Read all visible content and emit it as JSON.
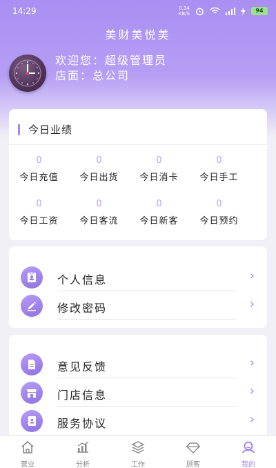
{
  "status_bar": {
    "time": "14:29",
    "net_speed_value": "0.34",
    "net_speed_unit": "KB/S",
    "battery": "94"
  },
  "app": {
    "title": "美财美悦美"
  },
  "user": {
    "welcome": "欢迎您：超级管理员",
    "store": "店面：总公司"
  },
  "performance": {
    "title": "今日业绩",
    "stats": [
      {
        "label": "今日充值",
        "value": "0"
      },
      {
        "label": "今日出货",
        "value": "0"
      },
      {
        "label": "今日消卡",
        "value": "0"
      },
      {
        "label": "今日手工",
        "value": "0"
      },
      {
        "label": "今日工资",
        "value": "0"
      },
      {
        "label": "今日客流",
        "value": "0"
      },
      {
        "label": "今日新客",
        "value": "0"
      },
      {
        "label": "今日预约",
        "value": "0"
      }
    ]
  },
  "menu1": [
    {
      "label": "个人信息",
      "icon": "id-card-icon"
    },
    {
      "label": "修改密码",
      "icon": "edit-pencil-icon"
    }
  ],
  "menu2": [
    {
      "label": "意见反馈",
      "icon": "document-icon"
    },
    {
      "label": "门店信息",
      "icon": "store-icon"
    },
    {
      "label": "服务协议",
      "icon": "agreement-book-icon"
    }
  ],
  "chevron": "›",
  "tabs": [
    {
      "label": "营业",
      "icon": "home-icon"
    },
    {
      "label": "分析",
      "icon": "chart-icon"
    },
    {
      "label": "工作",
      "icon": "layers-icon"
    },
    {
      "label": "顾客",
      "icon": "diamond-icon"
    },
    {
      "label": "我的",
      "icon": "user-icon",
      "active": true
    }
  ],
  "colors": {
    "accent": "#a58bf0",
    "header_top": "#a98ff2",
    "value": "#b8a3f3"
  }
}
